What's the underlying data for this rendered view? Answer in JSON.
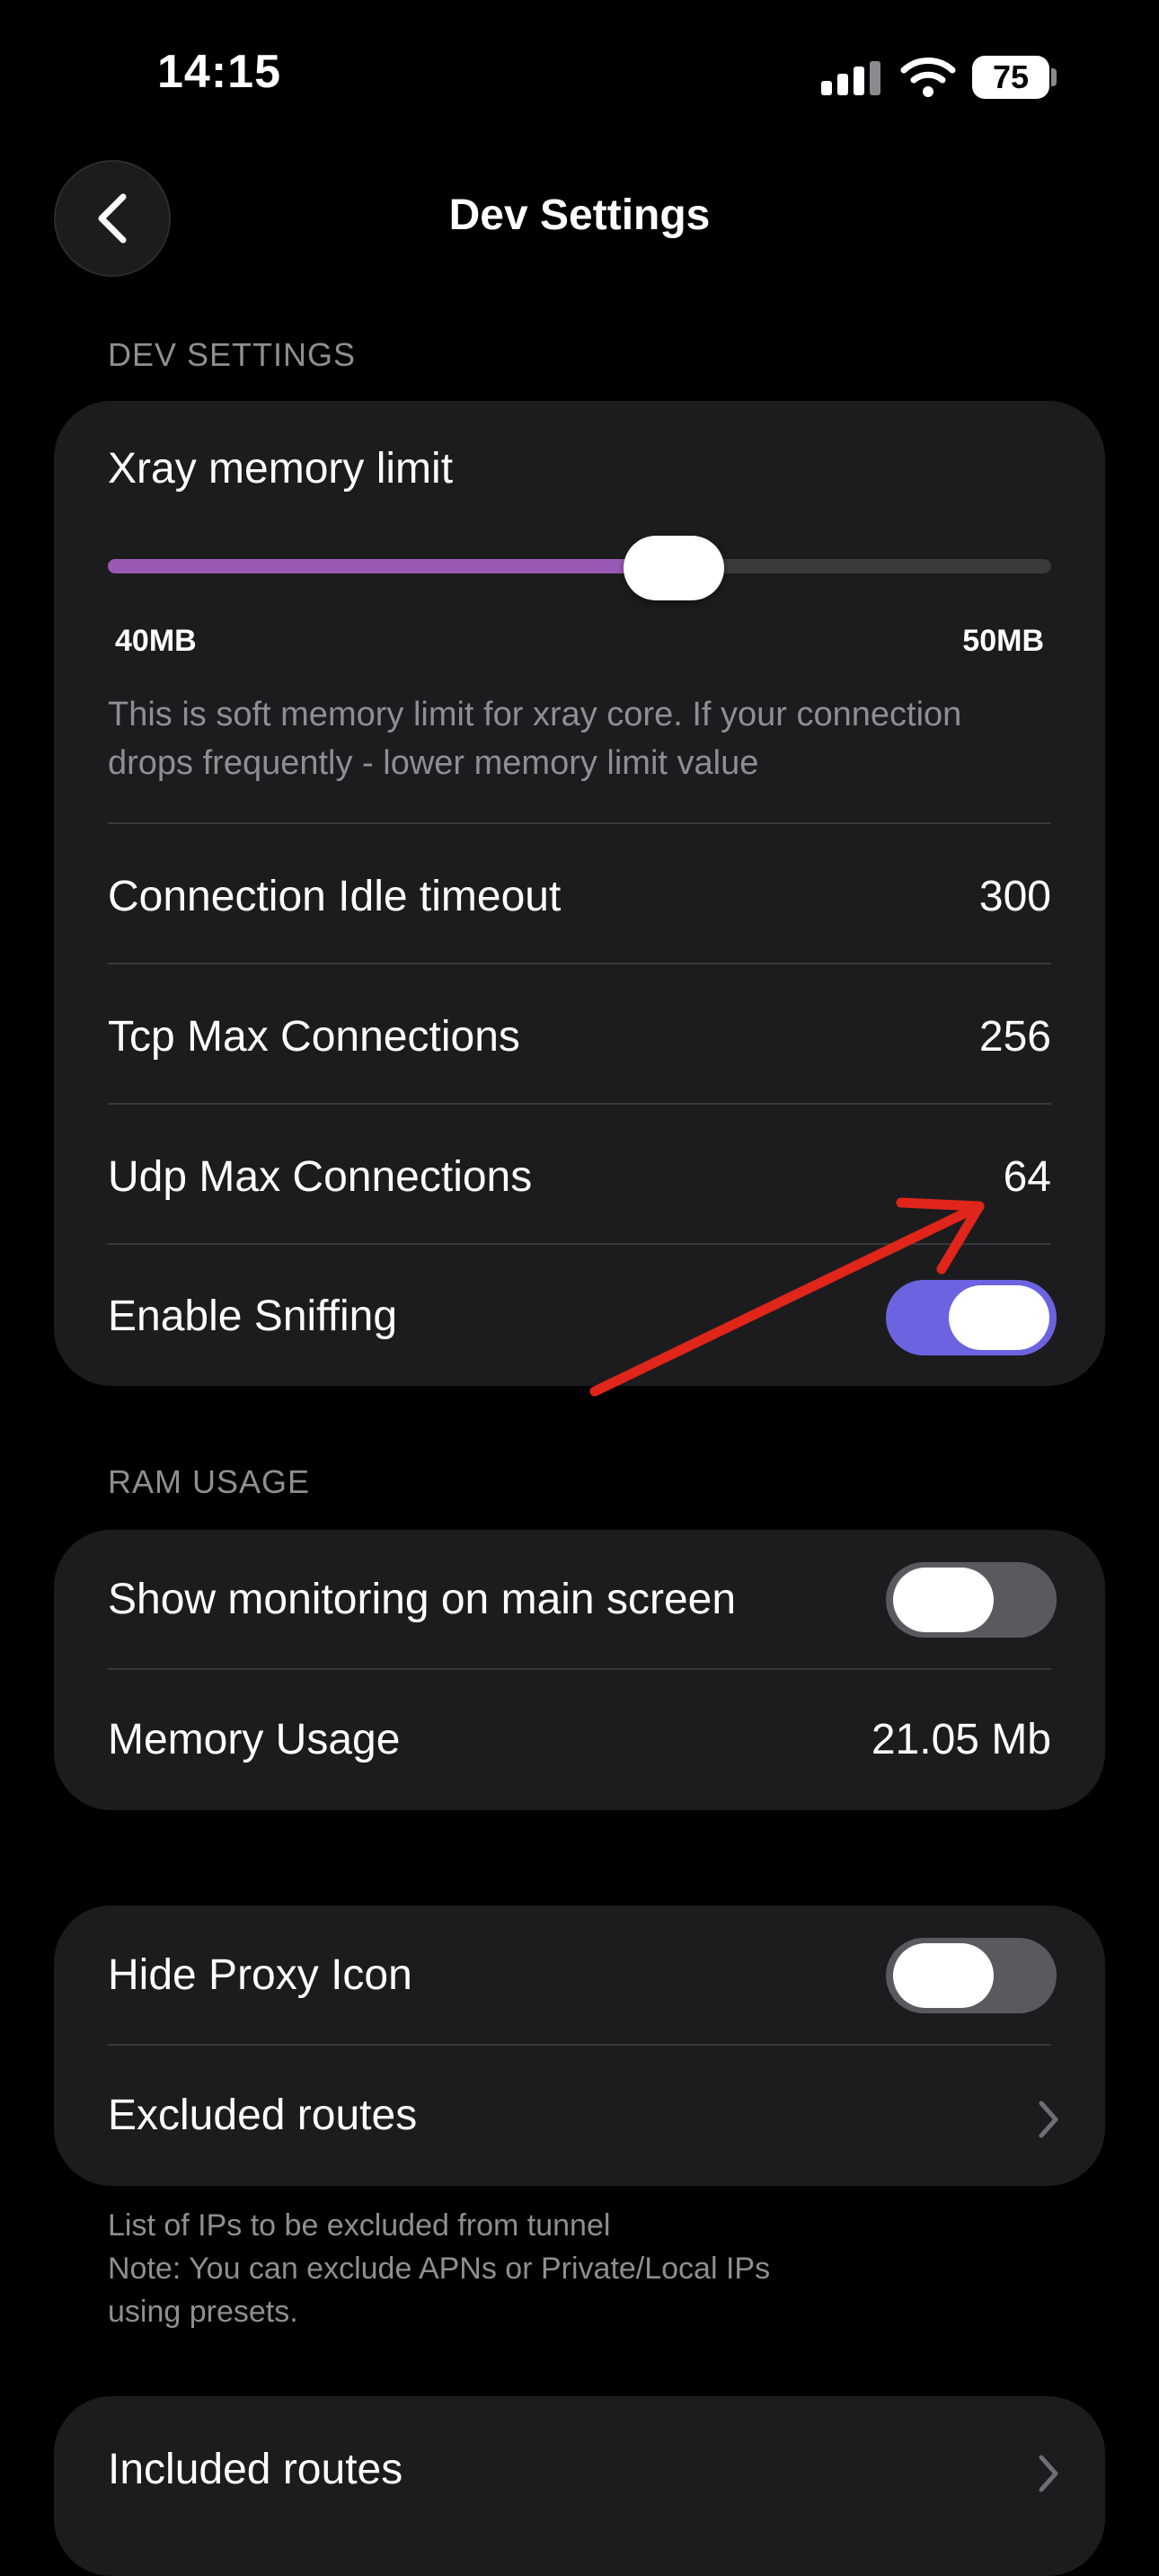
{
  "status_bar": {
    "time": "14:15",
    "battery": "75"
  },
  "nav": {
    "title": "Dev Settings"
  },
  "dev_settings": {
    "header": "DEV SETTINGS",
    "memory_limit": {
      "label": "Xray memory limit",
      "min_label": "40MB",
      "max_label": "50MB",
      "value_fraction": 0.6,
      "description_line1": "This is soft memory limit for xray core. If your connection",
      "description_line2": "drops frequently - lower memory limit value"
    },
    "rows": [
      {
        "label": "Connection Idle timeout",
        "value": "300"
      },
      {
        "label": "Tcp Max Connections",
        "value": "256"
      },
      {
        "label": "Udp Max Connections",
        "value": "64"
      }
    ],
    "sniffing": {
      "label": "Enable Sniffing",
      "enabled": true
    }
  },
  "ram_usage": {
    "header": "RAM USAGE",
    "monitoring": {
      "label": "Show monitoring on main screen",
      "enabled": false
    },
    "memory": {
      "label": "Memory Usage",
      "value": "21.05 Mb"
    }
  },
  "routing": {
    "hide_proxy": {
      "label": "Hide Proxy Icon",
      "enabled": false
    },
    "excluded": {
      "label": "Excluded routes"
    },
    "footnote_line1": "List of IPs to be excluded from tunnel",
    "footnote_line2": "Note: You can exclude APNs or Private/Local IPs",
    "footnote_line3": "using presets.",
    "included": {
      "label": "Included routes"
    }
  },
  "colors": {
    "accent_toggle": "#6c63e0",
    "slider_fill": "#9b59b6",
    "annotation_arrow": "#e0251b"
  }
}
